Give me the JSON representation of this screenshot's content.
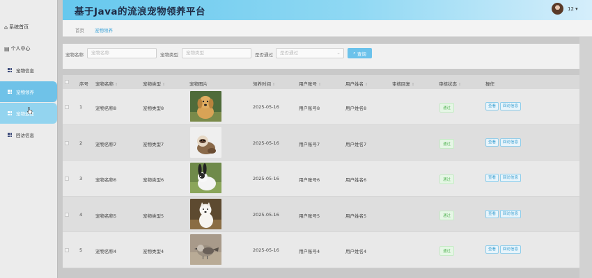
{
  "app": {
    "title": "基于Java的流浪宠物领养平台",
    "user": "12 ▾"
  },
  "sidebar": {
    "items": [
      {
        "label": "系统首页",
        "icon": "home-icon"
      },
      {
        "label": "个人中心",
        "icon": "profile-icon"
      },
      {
        "label": "宠物信息",
        "icon": "grid-icon"
      },
      {
        "label": "宠物领养",
        "icon": "grid-icon"
      },
      {
        "label": "宠物退还",
        "icon": "grid-icon"
      },
      {
        "label": "回访信息",
        "icon": "grid-icon"
      }
    ]
  },
  "breadcrumb": {
    "home": "首页",
    "current": "宠物领养"
  },
  "search": {
    "name_label": "宠物名称",
    "name_placeholder": "宠物名称",
    "type_label": "宠物类型",
    "type_placeholder": "宠物类型",
    "pass_label": "是否通过",
    "pass_placeholder": "是否通过",
    "query_label": "查询"
  },
  "table": {
    "headers": {
      "index": "序号",
      "name": "宠物名称",
      "type": "宠物类型",
      "photo": "宠物图片",
      "date": "领养时间",
      "account": "用户账号",
      "username": "用户姓名",
      "reply": "审核回复",
      "status": "审核状态",
      "ops": "操作"
    },
    "view_label": "查看",
    "visit_label": "回访信息",
    "rows": [
      {
        "index": "1",
        "name": "宠物名称8",
        "type": "宠物类型8",
        "date": "2025-05-16",
        "account": "用户账号8",
        "username": "用户姓名8",
        "reply": "",
        "status": "通过",
        "pet": "dog"
      },
      {
        "index": "2",
        "name": "宠物名称7",
        "type": "宠物类型7",
        "date": "2025-05-16",
        "account": "用户账号7",
        "username": "用户姓名7",
        "reply": "",
        "status": "通过",
        "pet": "ferret"
      },
      {
        "index": "3",
        "name": "宠物名称6",
        "type": "宠物类型6",
        "date": "2025-05-16",
        "account": "用户账号6",
        "username": "用户姓名6",
        "reply": "",
        "status": "通过",
        "pet": "rabbit"
      },
      {
        "index": "4",
        "name": "宠物名称5",
        "type": "宠物类型5",
        "date": "2025-05-16",
        "account": "用户账号5",
        "username": "用户姓名5",
        "reply": "",
        "status": "通过",
        "pet": "samoyed"
      },
      {
        "index": "5",
        "name": "宠物名称4",
        "type": "宠物类型4",
        "date": "2025-05-16",
        "account": "用户账号4",
        "username": "用户姓名4",
        "reply": "",
        "status": "通过",
        "pet": "bird"
      }
    ]
  },
  "colors": {
    "accent": "#6fc2e8",
    "success": "#5fb95f"
  }
}
